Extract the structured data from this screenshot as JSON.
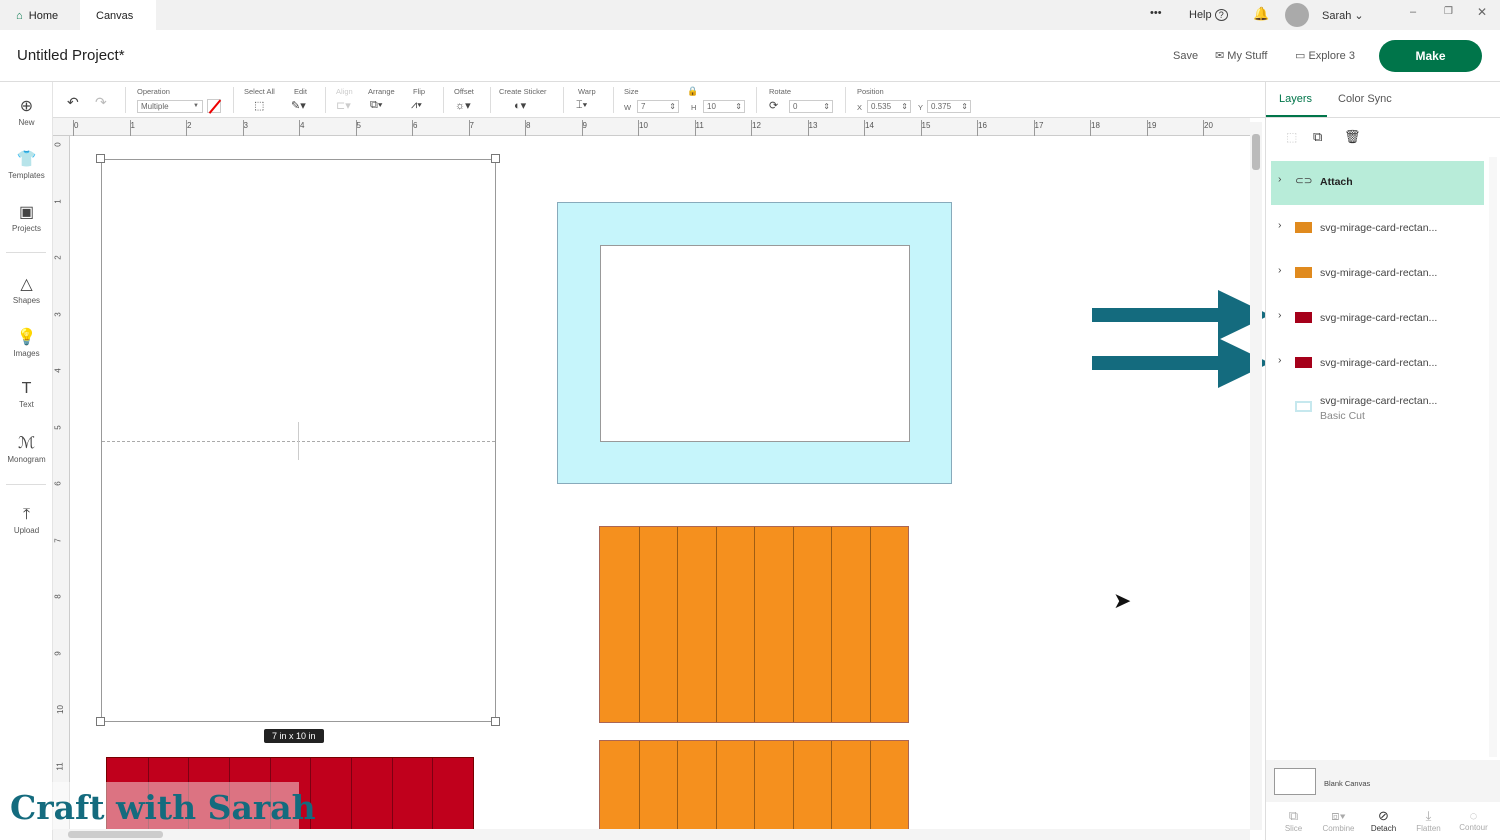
{
  "tabs": {
    "home": "Home",
    "canvas": "Canvas"
  },
  "topbar": {
    "more": "•••",
    "help": "Help",
    "user": "Sarah"
  },
  "title": {
    "project": "Untitled Project*",
    "save": "Save",
    "my_stuff": "My Stuff",
    "explore": "Explore 3",
    "make": "Make"
  },
  "sidebar": [
    {
      "label": "New",
      "icon": "⊕"
    },
    {
      "label": "Templates",
      "icon": "👕"
    },
    {
      "label": "Projects",
      "icon": "▣"
    },
    {
      "label": "Shapes",
      "icon": "△"
    },
    {
      "label": "Images",
      "icon": "💡"
    },
    {
      "label": "Text",
      "icon": "T"
    },
    {
      "label": "Monogram",
      "icon": "ℳ"
    },
    {
      "label": "Upload",
      "icon": "⤒"
    }
  ],
  "toolbar": {
    "operation_label": "Operation",
    "operation_value": "Multiple",
    "select_all": "Select All",
    "edit": "Edit",
    "align": "Align",
    "arrange": "Arrange",
    "flip": "Flip",
    "offset": "Offset",
    "create_sticker": "Create Sticker",
    "warp": "Warp",
    "size": "Size",
    "w_label": "W",
    "w": "7",
    "h_label": "H",
    "h": "10",
    "rotate": "Rotate",
    "rotate_value": "0",
    "position": "Position",
    "x_label": "X",
    "x": "0.535",
    "y_label": "Y",
    "y": "0.375"
  },
  "ruler": {
    "top": [
      "0",
      "1",
      "2",
      "3",
      "4",
      "5",
      "6",
      "7",
      "8",
      "9",
      "10",
      "11",
      "12",
      "13",
      "14",
      "15",
      "16",
      "17",
      "18",
      "19",
      "20"
    ],
    "left": [
      "0",
      "1",
      "2",
      "3",
      "4",
      "5",
      "6",
      "7",
      "8",
      "9",
      "10",
      "11"
    ]
  },
  "canvas": {
    "size_tooltip": "7 in x 10 in",
    "colors": {
      "light_blue": "#c6f5fb",
      "orange": "#f5901e",
      "red": "#c0001c"
    }
  },
  "panel": {
    "tab_layers": "Layers",
    "tab_color_sync": "Color Sync",
    "layers": [
      {
        "name": "Attach",
        "color": ""
      },
      {
        "name": "svg-mirage-card-rectan...",
        "color": "#e08a1e"
      },
      {
        "name": "svg-mirage-card-rectan...",
        "color": "#e08a1e"
      },
      {
        "name": "svg-mirage-card-rectan...",
        "color": "#a5001a"
      },
      {
        "name": "svg-mirage-card-rectan...",
        "color": "#a5001a"
      },
      {
        "name": "svg-mirage-card-rectan...",
        "sub": "Basic Cut",
        "color": "#c6f5fb"
      }
    ],
    "blank_canvas": "Blank Canvas",
    "bottom": [
      "Slice",
      "Combine",
      "Detach",
      "Flatten",
      "Contour"
    ]
  },
  "watermark": "Craft with Sarah",
  "colors": {
    "accent": "#00754a",
    "attach_bg": "#b8ecd9",
    "arrow": "#146b7e"
  }
}
